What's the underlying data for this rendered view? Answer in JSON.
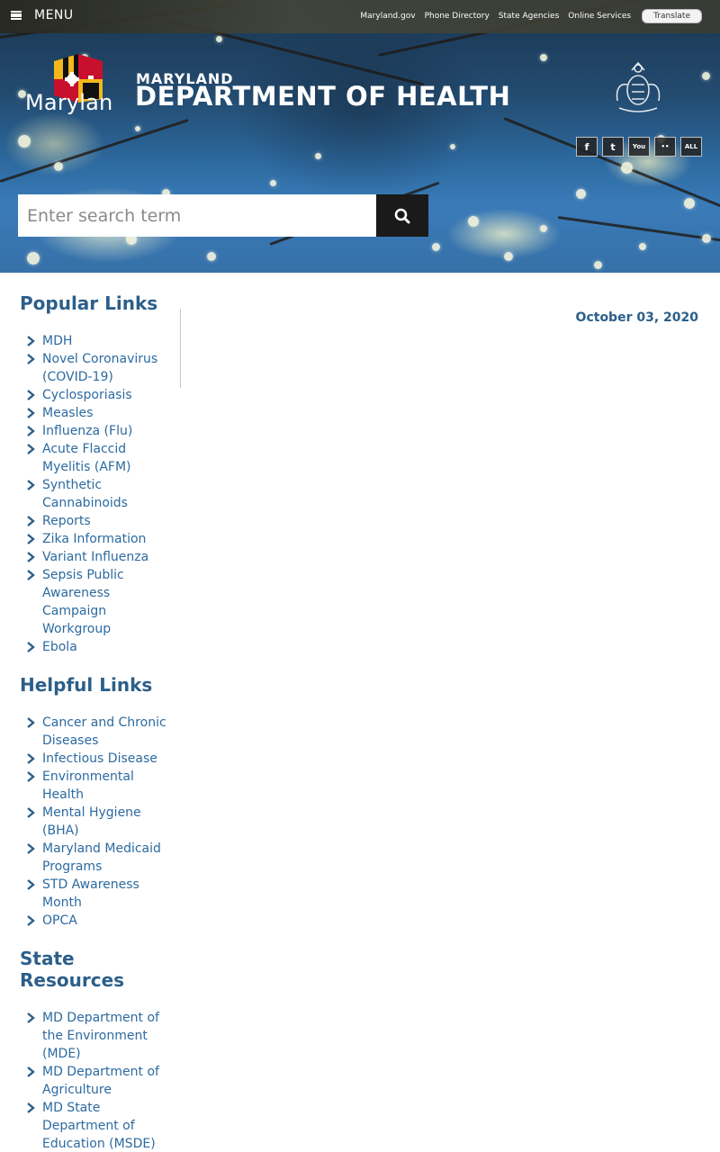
{
  "topbar": {
    "menu_label": "MENU",
    "links": [
      "Maryland.gov",
      "Phone Directory",
      "State Agencies",
      "Online Services"
    ],
    "translate_label": "Translate"
  },
  "header": {
    "logo_word": "Marylan",
    "dept_sub": "MARYLAND",
    "dept_main": "DEPARTMENT OF HEALTH",
    "social": [
      "f",
      "t",
      "You",
      "••",
      "ALL"
    ]
  },
  "search": {
    "placeholder": "Enter search term"
  },
  "date": "October 03, 2020",
  "sidebar": {
    "popular_heading": "Popular Links",
    "popular": [
      "MDH",
      "Novel Coronavirus (COVID-19)",
      "Cyclosporiasis",
      "Measles",
      "Influenza (Flu)",
      "Acute Flaccid Myelitis (AFM)",
      "Synthetic Cannabinoids",
      "Reports",
      "Zika Information",
      "Variant Influenza",
      "Sepsis Public Awareness Campaign Workgroup",
      "Ebola"
    ],
    "helpful_heading": "Helpful Links",
    "helpful": [
      "Cancer and Chronic Diseases",
      "Infectious Disease",
      "Environmental Health",
      "Mental Hygiene (BHA)",
      "Maryland Medicaid Programs",
      "STD Awareness Month",
      "OPCA"
    ],
    "state_heading": "State Resources",
    "state": [
      "MD Department of the Environment (MDE)",
      "MD Department of Agriculture",
      "MD State Department of Education (MSDE)"
    ]
  },
  "colors": {
    "heading": "#2c5f8a",
    "link": "#2c6aa0",
    "flag_red": "#c8102e",
    "flag_gold": "#f2b81c",
    "flag_black": "#111111"
  }
}
